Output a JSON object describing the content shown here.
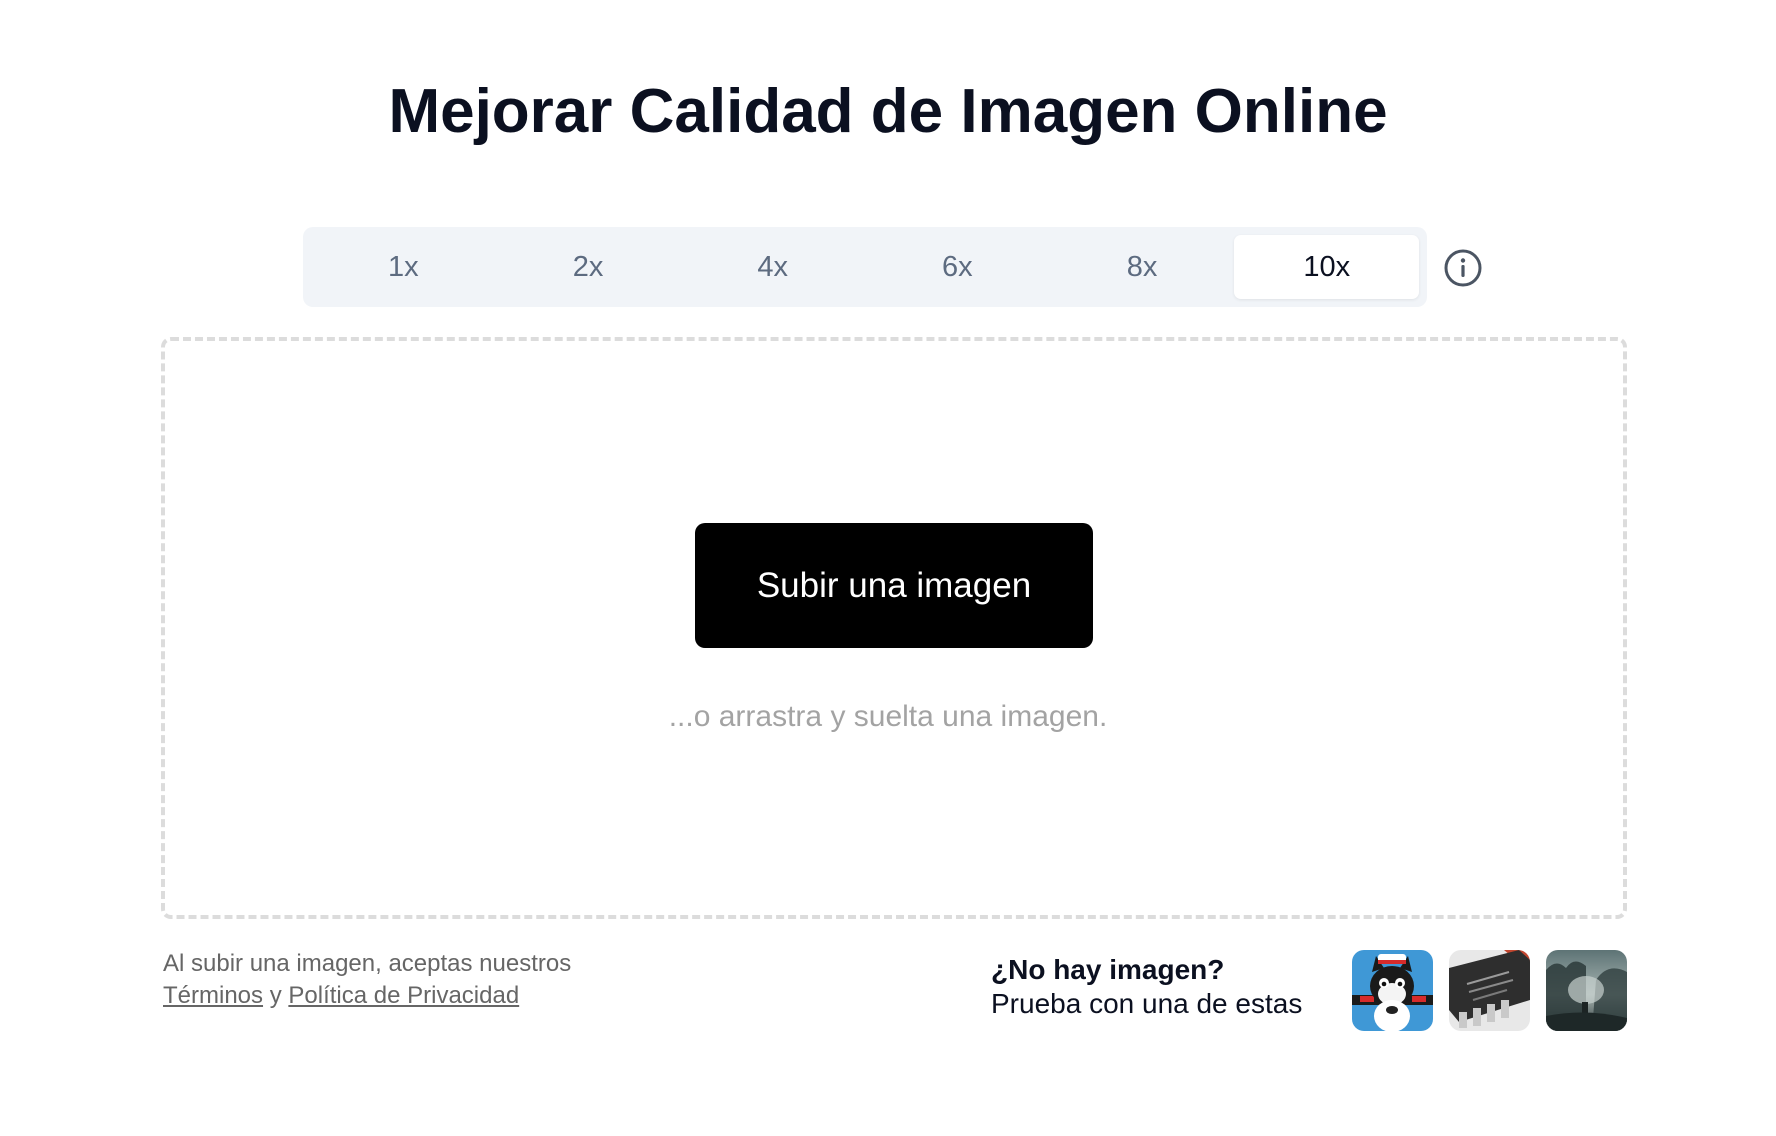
{
  "title": "Mejorar Calidad de Imagen Online",
  "scale_options": [
    "1x",
    "2x",
    "4x",
    "6x",
    "8x",
    "10x"
  ],
  "selected_scale": "10x",
  "upload": {
    "button_label": "Subir una imagen",
    "drop_hint": "...o arrastra y suelta una imagen."
  },
  "legal": {
    "prefix": "Al subir una imagen, aceptas nuestros",
    "terms_link": "Términos",
    "conjunction": "y",
    "privacy_link": "Política de Privacidad"
  },
  "samples": {
    "title": "¿No hay imagen?",
    "subtitle": "Prueba con una de estas",
    "thumbnails": [
      "cartoon-cat-sample",
      "microchip-sample",
      "misty-landscape-sample"
    ]
  },
  "colors": {
    "accent": "#000000",
    "title": "#0b1020",
    "muted": "#5d6b80",
    "tab_bg": "#f1f4f8",
    "dashed_border": "#dcdcdc"
  }
}
